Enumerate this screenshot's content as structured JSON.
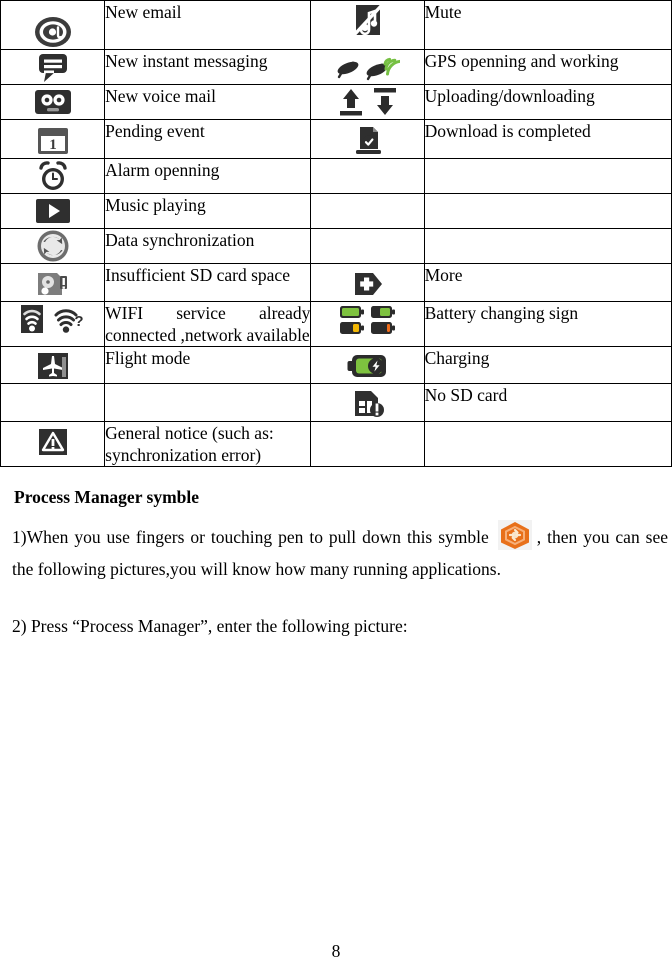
{
  "document": {
    "page_number": "8"
  },
  "status_icon_table": {
    "rows": [
      {
        "left_icon": "at-sign-email-icon",
        "left_label": "New email",
        "right_icon": "mute-icon",
        "right_label": "Mute"
      },
      {
        "left_icon": "chat-bubble-message-icon",
        "left_label": "New instant messaging",
        "right_icon": "gps-satellite-icon",
        "right_label": "GPS openning and working"
      },
      {
        "left_icon": "voicemail-tape-icon",
        "left_label": "New voice mail",
        "right_icon": "upload-download-arrows-icon",
        "right_label": "Uploading/downloading"
      },
      {
        "left_icon": "calendar-event-icon",
        "left_label": "Pending event",
        "right_icon": "download-complete-icon",
        "right_label": "Download is completed"
      },
      {
        "left_icon": "alarm-clock-icon",
        "left_label": "Alarm openning",
        "right_icon": "",
        "right_label": ""
      },
      {
        "left_icon": "music-play-icon",
        "left_label": "Music playing",
        "right_icon": "",
        "right_label": ""
      },
      {
        "left_icon": "data-sync-icon",
        "left_label": "Data synchronization",
        "right_icon": "",
        "right_label": ""
      },
      {
        "left_icon": "sd-card-warning-icon",
        "left_label": "Insufficient SD card space",
        "right_icon": "more-plus-icon",
        "right_label": "More"
      },
      {
        "left_icon": "wifi-connected-icon",
        "left_label": "WIFI service already connected ,network available",
        "right_icon": "battery-levels-icon",
        "right_label": "Battery changing sign"
      },
      {
        "left_icon": "flight-mode-icon",
        "left_label": "Flight mode",
        "right_icon": "battery-charging-icon",
        "right_label": "Charging"
      },
      {
        "left_icon": "",
        "left_label": "",
        "right_icon": "no-sd-card-icon",
        "right_label": "No SD card"
      },
      {
        "left_icon": "general-notice-icon",
        "left_label": "General notice (such as: synchronization error)",
        "right_icon": "",
        "right_label": ""
      }
    ]
  },
  "process_manager_section": {
    "title": "Process Manager symble",
    "step1_before_icon": "1)When you use fingers or touching pen to pull down this symble",
    "step1_icon": "process-manager-hexagon-icon",
    "step1_after_icon": ", then you can see the following pictures,you will know how many running applications.",
    "step2": "2) Press “Process Manager”, enter the following picture:"
  },
  "colors": {
    "border": "#000000",
    "text": "#000000",
    "icon_dark": "#2b2b2b",
    "icon_mid": "#555555",
    "gps_green": "#76c043",
    "battery_green": "#7ec23f",
    "battery_yellow": "#f2b705",
    "battery_orange": "#ef6c1a",
    "hex_orange": "#e8701a",
    "hex_orange_light": "#f39a4e"
  }
}
